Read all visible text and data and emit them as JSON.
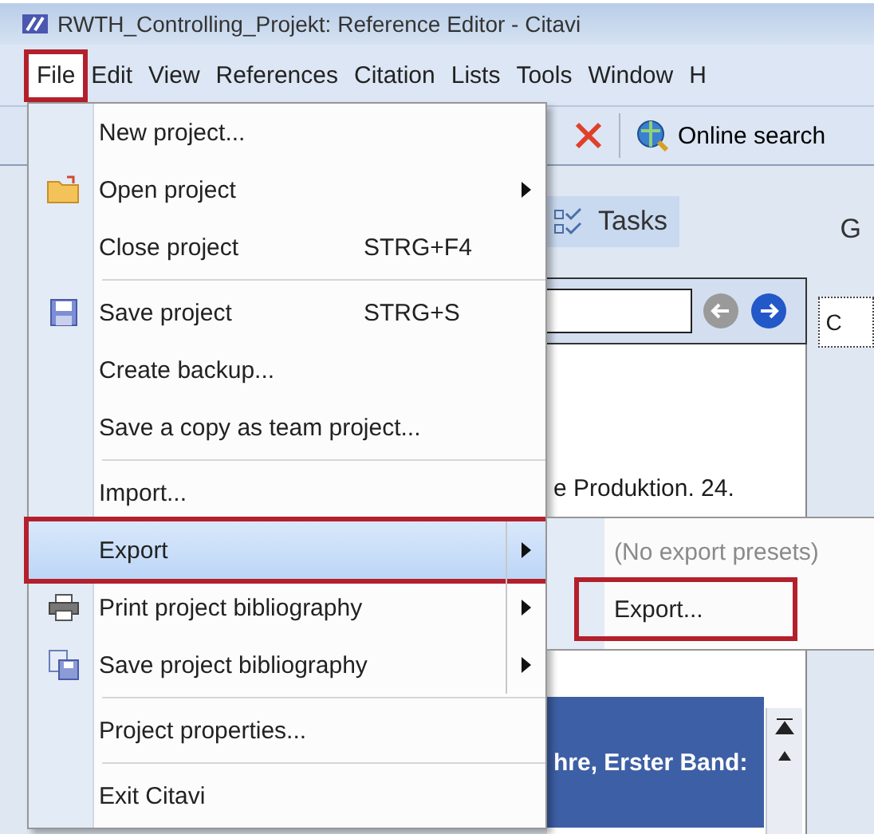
{
  "window": {
    "title": "RWTH_Controlling_Projekt: Reference Editor - Citavi"
  },
  "menu_bar": [
    {
      "label": "File",
      "selected": true,
      "highlighted": true
    },
    {
      "label": "Edit",
      "selected": false,
      "highlighted": false
    },
    {
      "label": "View",
      "selected": false,
      "highlighted": false
    },
    {
      "label": "References",
      "selected": false,
      "highlighted": false
    },
    {
      "label": "Citation",
      "selected": false,
      "highlighted": false
    },
    {
      "label": "Lists",
      "selected": false,
      "highlighted": false
    },
    {
      "label": "Tools",
      "selected": false,
      "highlighted": false
    },
    {
      "label": "Window",
      "selected": false,
      "highlighted": false
    },
    {
      "label": "H",
      "selected": false,
      "highlighted": false
    }
  ],
  "toolbar": {
    "online_search": "Online search"
  },
  "tabs": [
    {
      "label": "Tasks",
      "selected": true
    },
    {
      "label": "G",
      "selected": false
    }
  ],
  "right_pane": {
    "label": "C"
  },
  "reference_list": [
    {
      "text": "e Produktion. 24.",
      "selected": false
    },
    {
      "text": "hre, Erster Band:",
      "selected": true
    }
  ],
  "file_menu": [
    {
      "kind": "item",
      "label": "New project...",
      "submenu": false,
      "selected": false,
      "highlighted": false
    },
    {
      "kind": "item",
      "label": "Open project",
      "submenu": true,
      "selected": false,
      "highlighted": false
    },
    {
      "kind": "item",
      "label": "Close project",
      "shortcut": "STRG+F4",
      "submenu": false,
      "selected": false,
      "highlighted": false
    },
    {
      "kind": "separator"
    },
    {
      "kind": "item",
      "label": "Save project",
      "shortcut": "STRG+S",
      "submenu": false,
      "selected": false,
      "highlighted": false
    },
    {
      "kind": "item",
      "label": "Create backup...",
      "submenu": false,
      "selected": false,
      "highlighted": false
    },
    {
      "kind": "item",
      "label": "Save a copy as team project...",
      "submenu": false,
      "selected": false,
      "highlighted": false
    },
    {
      "kind": "separator"
    },
    {
      "kind": "item",
      "label": "Import...",
      "submenu": false,
      "selected": false,
      "highlighted": false
    },
    {
      "kind": "item",
      "label": "Export",
      "submenu": true,
      "selected": true,
      "highlighted": true
    },
    {
      "kind": "item",
      "label": "Print project bibliography",
      "submenu": true,
      "selected": false,
      "highlighted": false
    },
    {
      "kind": "item",
      "label": "Save project bibliography",
      "submenu": true,
      "selected": false,
      "highlighted": false
    },
    {
      "kind": "separator"
    },
    {
      "kind": "item",
      "label": "Project properties...",
      "submenu": false,
      "selected": false,
      "highlighted": false
    },
    {
      "kind": "separator"
    },
    {
      "kind": "item",
      "label": "Exit Citavi",
      "submenu": false,
      "selected": false,
      "highlighted": false
    }
  ],
  "export_submenu": [
    {
      "label": "(No export presets)",
      "disabled": true,
      "highlighted": false
    },
    {
      "label": "Export...",
      "disabled": false,
      "highlighted": true
    }
  ]
}
